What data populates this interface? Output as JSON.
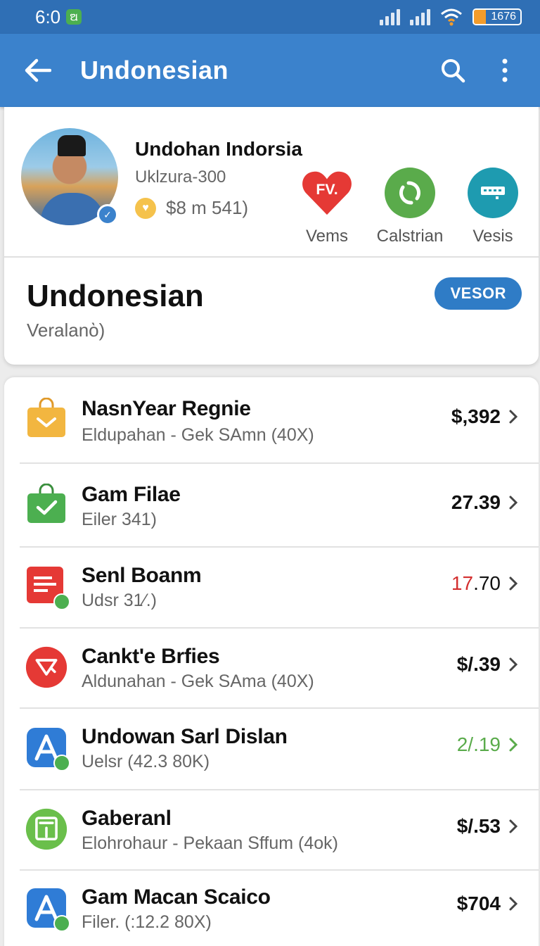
{
  "status_bar": {
    "time": "6:0",
    "app_badge": "ଅ",
    "battery_text": "1676",
    "battery_level_percent": 25,
    "accent": "#f39c2b"
  },
  "app_bar": {
    "title": "Undonesian",
    "icons": [
      "back-arrow-icon",
      "search-icon",
      "more-vert-icon"
    ]
  },
  "profile": {
    "name": "Undohan Indorsia",
    "subtitle": "Uklzura-300",
    "balance": "$8 m 541)",
    "quick_actions": [
      {
        "label": "Vems",
        "icon_text": "FV.",
        "color": "#e53935",
        "icon": "heart-icon"
      },
      {
        "label": "Calstrian",
        "color": "#5aab4b",
        "icon": "refresh-icon"
      },
      {
        "label": "Vesis",
        "color": "#1e9bb0",
        "icon": "card-icon"
      }
    ]
  },
  "section": {
    "title": "Undonesian",
    "subtitle": "Veralanὸ)",
    "pill_label": "VESOR"
  },
  "items": [
    {
      "title": "NasnYear Regnie",
      "subtitle": "Eldupahan - Gek SAmn (40X)",
      "amount": "$,392",
      "amount_color": "#111111",
      "icon": "shopping-bag-icon",
      "icon_color": "#f2b640"
    },
    {
      "title": "Gam Filae",
      "subtitle": "Eiler 341)",
      "amount": "27.39",
      "amount_color": "#111111",
      "icon": "check-bag-icon",
      "icon_color": "#4caf50"
    },
    {
      "title": "Senl Boanm",
      "subtitle": "Udsr 31⁄.)",
      "amount_red": "17",
      "amount_rest": ".70",
      "amount_color": "#d32f2f",
      "icon": "document-icon",
      "icon_color": "#e53935"
    },
    {
      "title": "Cankt'e Brfies",
      "subtitle": "Aldunahan - Gek SAma (40X)",
      "amount": "$/.39",
      "amount_color": "#111111",
      "icon": "tag-icon",
      "icon_color": "#e53935"
    },
    {
      "title": "Undowan Sarl Dislan",
      "subtitle": "Uelsr (42.3 80K)",
      "amount": "2/.19",
      "amount_color": "#5aab4b",
      "icon": "app-store-icon",
      "icon_color": "#2f7cd6"
    },
    {
      "title": "Gaberanl",
      "subtitle": "Elohrohaur - Pekaan Sffum (4ok)",
      "amount": "$/.53",
      "amount_color": "#111111",
      "icon": "kiosk-icon",
      "icon_color": "#6abf4b"
    },
    {
      "title": "Gam Macan Scaico",
      "subtitle": "Filer. (:12.2 80X)",
      "amount": "$704",
      "amount_color": "#111111",
      "icon": "app-store-icon",
      "icon_color": "#2f7cd6"
    }
  ]
}
